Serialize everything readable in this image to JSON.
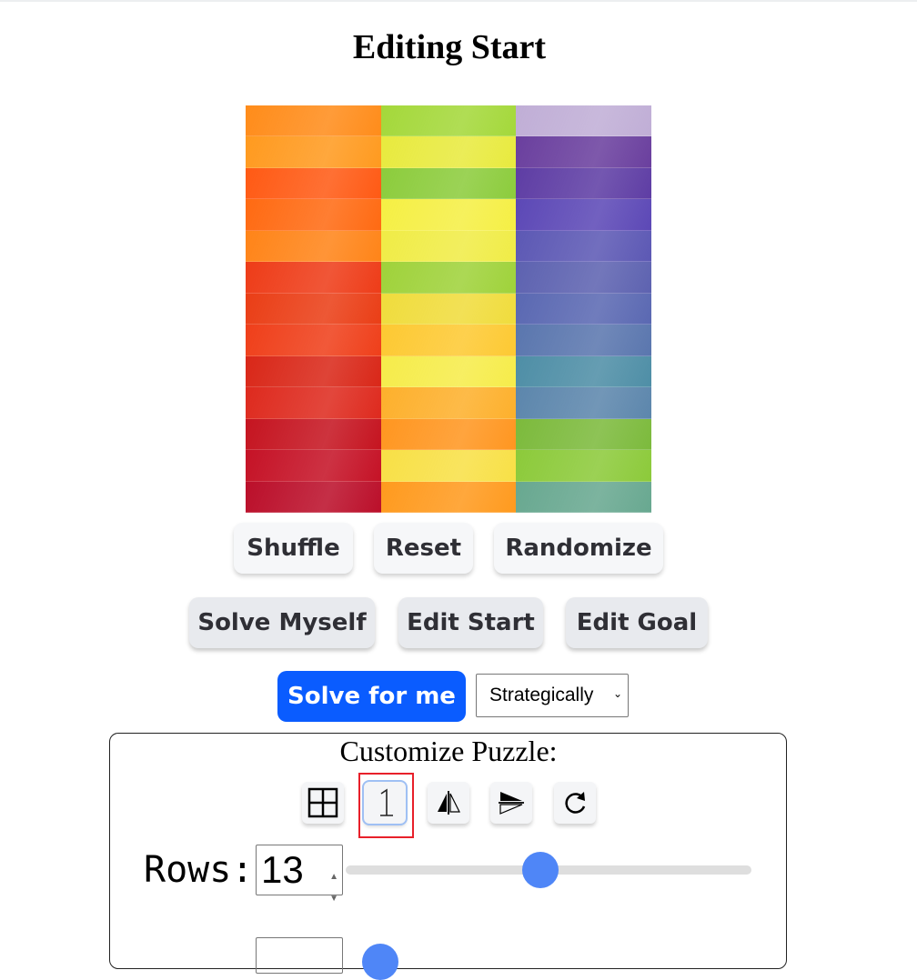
{
  "header": {
    "title": "Editing Start"
  },
  "puzzle": {
    "rows": 13,
    "cols": 3,
    "column_colors": [
      [
        "#ff8c1a",
        "#ff9a1f",
        "#ff5a14",
        "#ff6a12",
        "#ff8418",
        "#ee3c18",
        "#ea3e16",
        "#ef3f1a",
        "#d92718",
        "#de2a1e",
        "#c51420",
        "#c51226",
        "#bb0f2a"
      ],
      [
        "#a4d83a",
        "#e8ea3e",
        "#8ccc3c",
        "#f5ef44",
        "#f0ec46",
        "#9fd23a",
        "#f0dc3c",
        "#fdc932",
        "#f6ec4a",
        "#fdb02c",
        "#ff9620",
        "#f8e046",
        "#ff9a1e"
      ],
      [
        "#c0aed6",
        "#6a3f9e",
        "#5e3da4",
        "#5c48b6",
        "#5c58b4",
        "#5d62b0",
        "#5a68b2",
        "#5a76ae",
        "#4e8ea6",
        "#5c86ac",
        "#7cba3c",
        "#8cca3a",
        "#68a890"
      ]
    ]
  },
  "buttons": {
    "shuffle": "Shuffle",
    "reset": "Reset",
    "randomize": "Randomize",
    "solve_myself": "Solve Myself",
    "edit_start": "Edit Start",
    "edit_goal": "Edit Goal",
    "solve_for_me": "Solve for me"
  },
  "strategy_select": {
    "value": "Strategically"
  },
  "customize": {
    "title": "Customize Puzzle:",
    "tools": [
      "grid-icon",
      "number-one-icon",
      "flip-horizontal-icon",
      "flip-vertical-icon",
      "rotate-icon"
    ],
    "rows_label": "Rows:",
    "rows_value": "13",
    "rows_slider_fraction": 0.48
  }
}
